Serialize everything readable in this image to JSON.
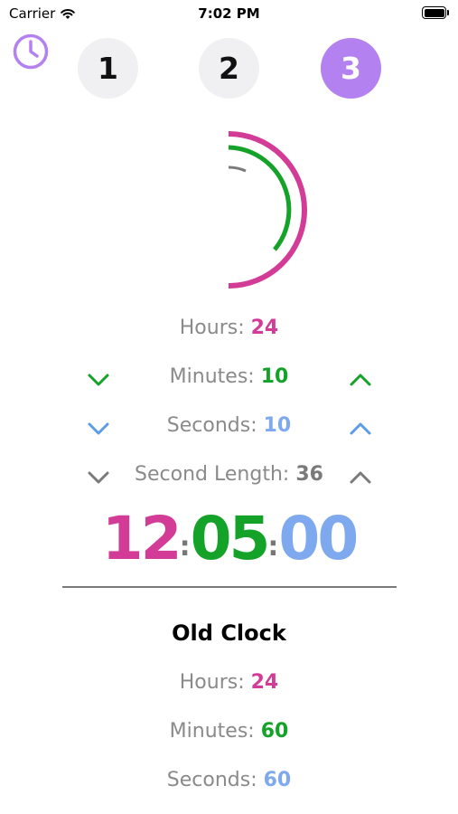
{
  "status_bar": {
    "carrier": "Carrier",
    "time": "7:02 PM",
    "battery_level": 1.0
  },
  "tabs": [
    {
      "label": "1",
      "selected": false
    },
    {
      "label": "2",
      "selected": false
    },
    {
      "label": "3",
      "selected": true
    }
  ],
  "colors": {
    "hours": "#d23c97",
    "minutes": "#14a228",
    "seconds": "#7ea9ef",
    "second_length": "#7a7a7a",
    "accent": "#b482f0"
  },
  "settings": {
    "hours": {
      "label": "Hours:",
      "value": "24"
    },
    "minutes": {
      "label": "Minutes:",
      "value": "10"
    },
    "seconds": {
      "label": "Seconds:",
      "value": "10"
    },
    "second_length": {
      "label": "Second Length:",
      "value": "36"
    }
  },
  "clock_display": {
    "hours": "12",
    "minutes": "05",
    "seconds": "00",
    "separator": ":"
  },
  "old_clock": {
    "title": "Old Clock",
    "hours": {
      "label": "Hours:",
      "value": "24"
    },
    "minutes": {
      "label": "Minutes:",
      "value": "60"
    },
    "seconds": {
      "label": "Seconds:",
      "value": "60"
    }
  },
  "icons": {
    "clock_button": "clock-icon",
    "decrement": "chevron-down-icon",
    "increment": "chevron-up-icon"
  }
}
